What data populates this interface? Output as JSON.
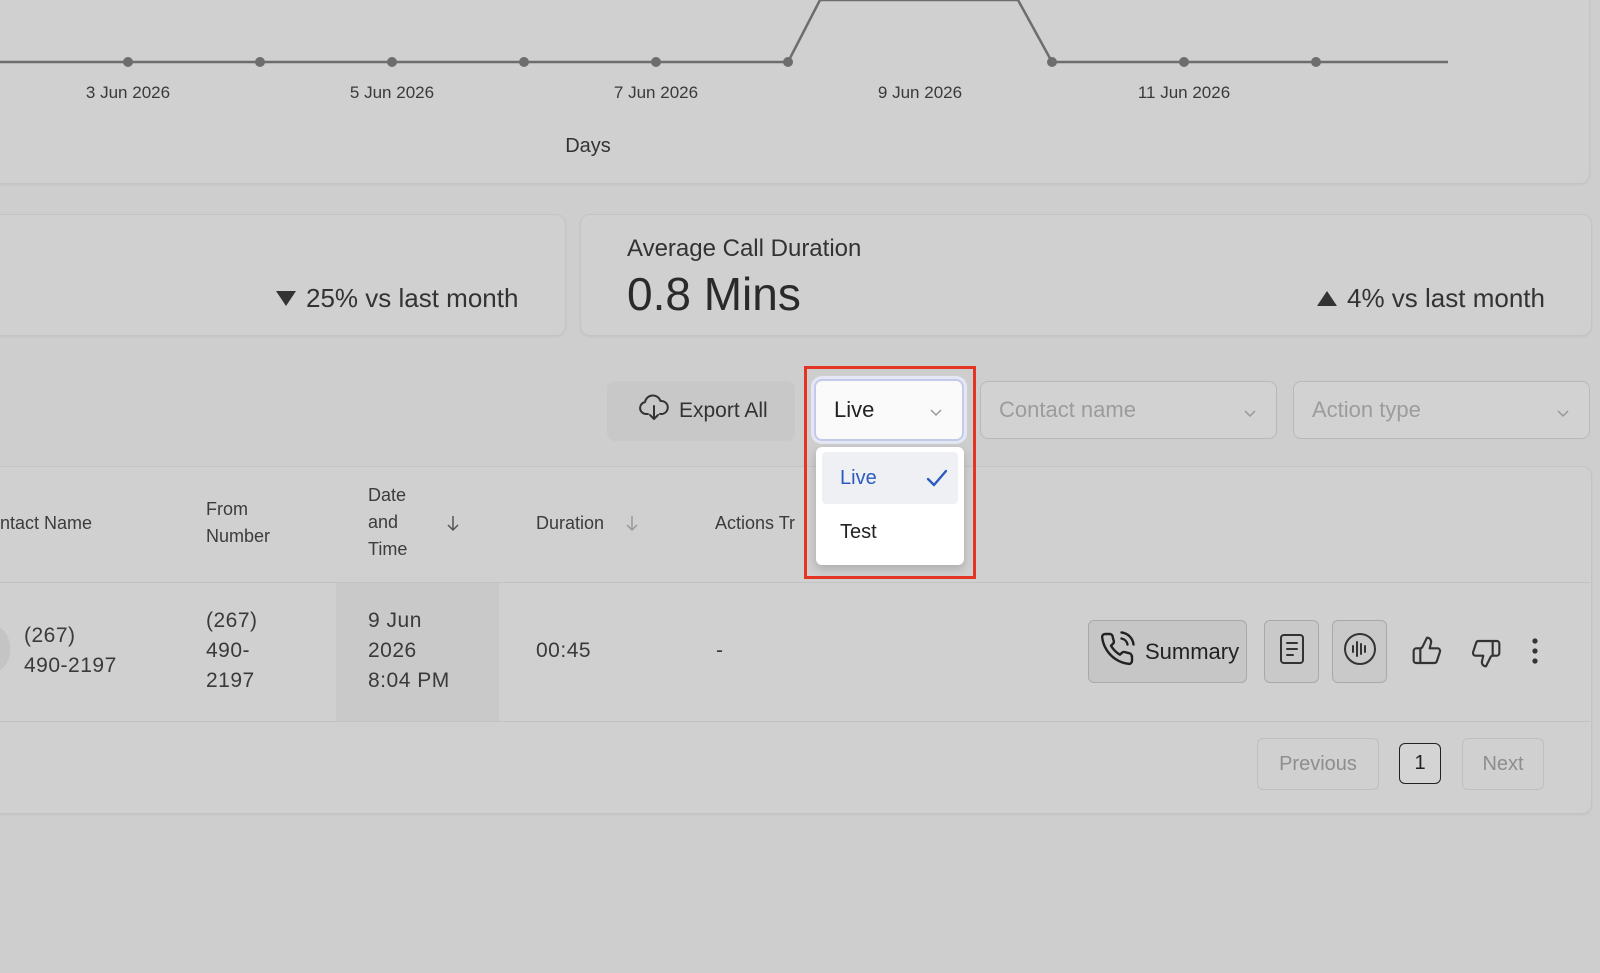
{
  "chart": {
    "x_ticks": [
      "3 Jun 2026",
      "5 Jun 2026",
      "7 Jun 2026",
      "9 Jun 2026",
      "11 Jun 2026"
    ],
    "x_label": "Days"
  },
  "stats": {
    "left": {
      "delta": "25% vs last month",
      "direction": "down"
    },
    "right": {
      "title": "Average Call Duration",
      "value": "0.8 Mins",
      "delta": "4% vs last month",
      "direction": "up"
    }
  },
  "toolbar": {
    "export_label": "Export All",
    "environment_select": {
      "value": "Live"
    },
    "contact_name": {
      "placeholder": "Contact name"
    },
    "action_type": {
      "placeholder": "Action type"
    }
  },
  "dropdown": {
    "options": [
      {
        "label": "Live",
        "selected": true
      },
      {
        "label": "Test",
        "selected": false
      }
    ],
    "selected_color": "#2c5bbf",
    "highlight_color": "#e43524"
  },
  "table": {
    "headers": {
      "contact_name": "ntact Name",
      "from_number_line1": "From",
      "from_number_line2": "Number",
      "date_line1": "Date",
      "date_line2": "and",
      "date_line3": "Time",
      "duration": "Duration",
      "actions": "Actions Tr"
    },
    "rows": [
      {
        "contact_line1": "(267)",
        "contact_line2": "490-2197",
        "from_line1": "(267)",
        "from_line2": "490-",
        "from_line3": "2197",
        "date_line1": "9 Jun",
        "date_line2": "2026",
        "date_line3": "8:04 PM",
        "duration": "00:45",
        "actions": "-",
        "summary_label": "Summary"
      }
    ]
  },
  "pagination": {
    "previous": "Previous",
    "current": "1",
    "next": "Next"
  }
}
